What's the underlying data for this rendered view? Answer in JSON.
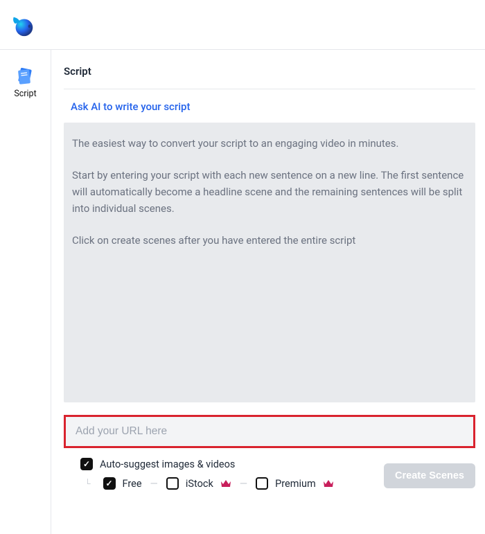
{
  "header": {
    "logo_name": "bird-logo"
  },
  "sidebar": {
    "items": [
      {
        "label": "Script",
        "icon": "script-icon"
      }
    ]
  },
  "main": {
    "heading": "Script",
    "ai_link": "Ask AI to write your script",
    "script_placeholder_p1": "The easiest way to convert your script to an engaging video in minutes.",
    "script_placeholder_p2": "Start by entering your script with each new sentence on a new line. The first sentence will automatically become a headline scene and the remaining sentences will be split into individual scenes.",
    "script_placeholder_p3": "Click on create scenes after you have entered the entire script",
    "url_placeholder": "Add your URL here",
    "options": {
      "auto_suggest_label": "Auto-suggest images & videos",
      "auto_suggest_checked": true,
      "free_label": "Free",
      "free_checked": true,
      "istock_label": "iStock",
      "istock_checked": false,
      "premium_label": "Premium",
      "premium_checked": false
    },
    "create_button_label": "Create Scenes"
  }
}
